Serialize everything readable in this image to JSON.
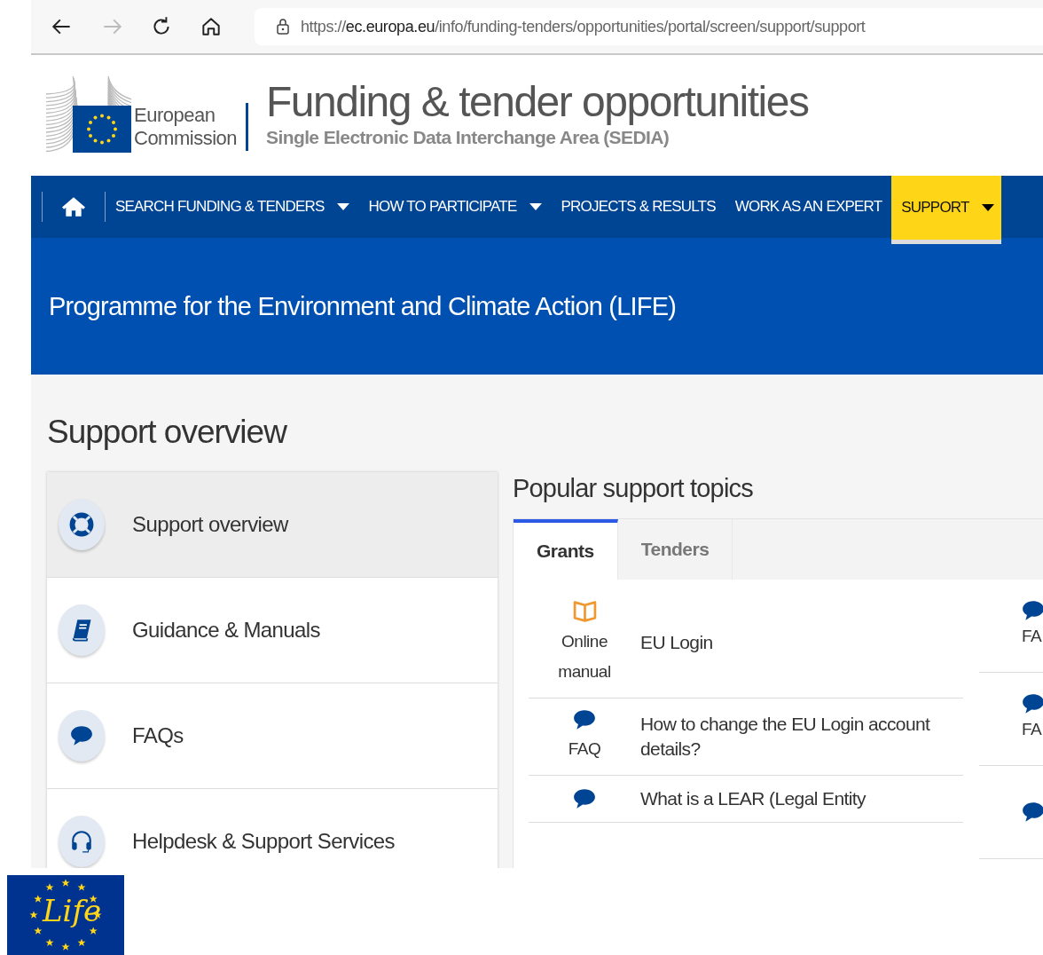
{
  "browser": {
    "url_host_prefix": "https://",
    "url_host": "ec.europa.eu",
    "url_path": "/info/funding-tenders/opportunities/portal/screen/support/support"
  },
  "header": {
    "logo_line_1": "European",
    "logo_line_2": "Commission",
    "title": "Funding & tender opportunities",
    "subtitle": "Single Electronic Data Interchange Area (SEDIA)"
  },
  "nav": [
    {
      "label": "SEARCH FUNDING & TENDERS",
      "dropdown": true,
      "selected": false
    },
    {
      "label": "HOW TO PARTICIPATE",
      "dropdown": true,
      "selected": false
    },
    {
      "label": "PROJECTS & RESULTS",
      "dropdown": false,
      "selected": false
    },
    {
      "label": "WORK AS AN EXPERT",
      "dropdown": false,
      "selected": false
    },
    {
      "label": "SUPPORT",
      "dropdown": true,
      "selected": true
    }
  ],
  "banner": {
    "title": "Programme for the Environment and Climate Action (LIFE)"
  },
  "page_title": "Support overview",
  "sidebar": [
    {
      "label": "Support overview",
      "kind": "lifebuoy",
      "selected": true
    },
    {
      "label": "Guidance & Manuals",
      "kind": "book",
      "selected": false
    },
    {
      "label": "FAQs",
      "kind": "speech",
      "selected": false
    },
    {
      "label": "Helpdesk & Support Services",
      "kind": "headset",
      "selected": false
    }
  ],
  "popular": {
    "title": "Popular support topics",
    "tabs": [
      {
        "label": "Grants",
        "selected": true
      },
      {
        "label": "Tenders",
        "selected": false
      }
    ],
    "topics": [
      {
        "kind": "manual",
        "type_label": "Online manual",
        "title": "EU Login"
      },
      {
        "kind": "faq",
        "type_label": "FAQ",
        "title": "How to change the EU Login account details?"
      },
      {
        "kind": "faq",
        "title": "What is a LEAR (Legal Entity"
      }
    ],
    "side_topics": [
      {
        "kind": "faq",
        "type_label": "FA"
      },
      {
        "kind": "faq",
        "type_label": "FA"
      },
      {
        "kind": "faq"
      }
    ]
  },
  "footer_logo": {
    "text": "Life"
  }
}
